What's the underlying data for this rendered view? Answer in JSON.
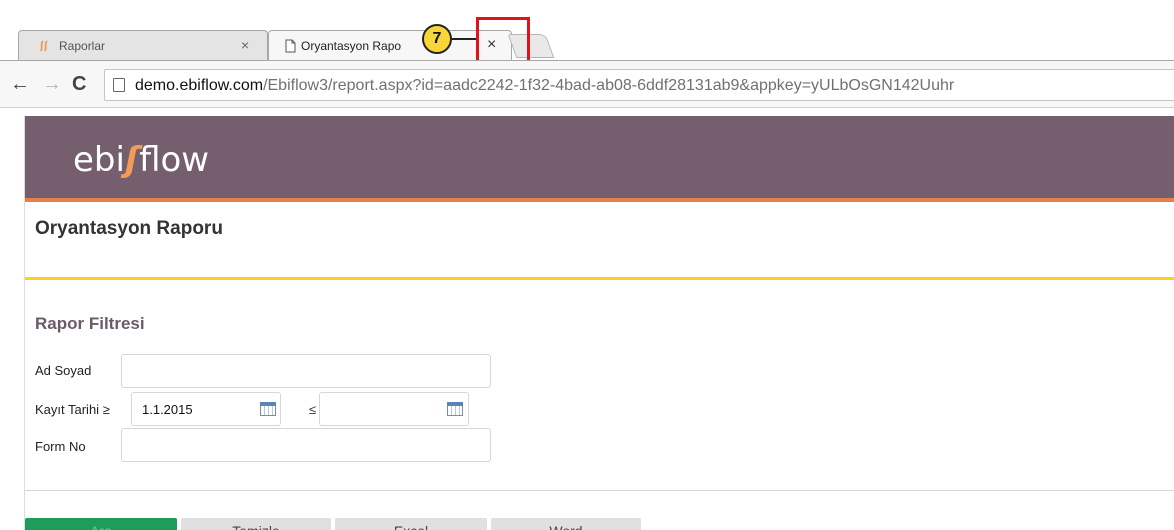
{
  "browser": {
    "tabs": [
      {
        "label": "Raporlar",
        "close": "×"
      },
      {
        "label": "Oryantasyon Rapo",
        "close": "×"
      }
    ],
    "address": {
      "domain": "demo.ebiflow.com",
      "path": "/Ebiflow3/report.aspx?id=aadc2242-1f32-4bad-ab08-6ddf28131ab9&appkey=yULbOsGN142Uuhr"
    },
    "nav": {
      "back": "←",
      "forward": "→",
      "reload": "C"
    }
  },
  "annotation": {
    "step": "7",
    "color": "#e0121b"
  },
  "app": {
    "logo_left": "ebi",
    "logo_mark": "ʃ",
    "logo_right": "flow",
    "header_color": "#755f6e",
    "page_title": "Oryantasyon Raporu"
  },
  "filter": {
    "title": "Rapor Filtresi",
    "name_label": "Ad Soyad",
    "name_value": "",
    "date_label": "Kayıt Tarihi",
    "date_from_op": "≥",
    "date_from_value": "1.1.2015",
    "date_to_op": "≤",
    "date_to_value": "",
    "form_label": "Form No",
    "form_value": ""
  },
  "actions": {
    "search": "Ara",
    "clear": "Temizle",
    "excel": "Excel",
    "word": "Word"
  }
}
